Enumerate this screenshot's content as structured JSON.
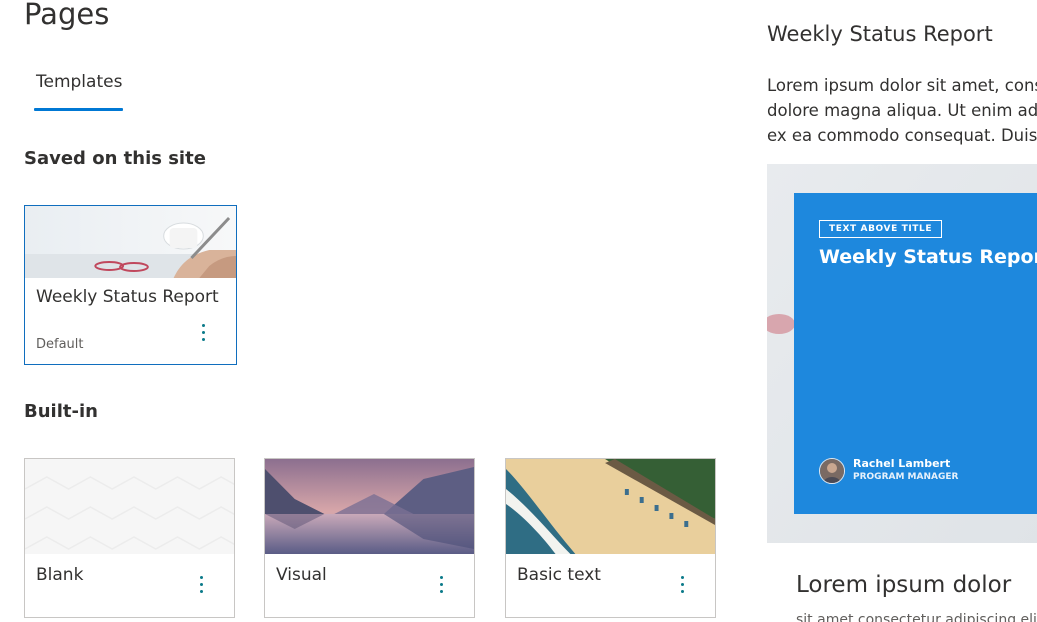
{
  "page": {
    "title": "Pages"
  },
  "tabs": [
    {
      "label": "Templates",
      "active": true
    }
  ],
  "sections": {
    "saved": {
      "heading": "Saved on this site",
      "templates": [
        {
          "name": "Weekly Status Report",
          "subtitle": "Default",
          "thumbnail": "desk-writing-photo",
          "selected": true
        }
      ]
    },
    "builtin": {
      "heading": "Built-in",
      "templates": [
        {
          "name": "Blank",
          "thumbnail": "white-geometric-pattern"
        },
        {
          "name": "Visual",
          "thumbnail": "mountain-lake-photo"
        },
        {
          "name": "Basic text",
          "thumbnail": "aerial-beach-photo"
        }
      ]
    }
  },
  "preview": {
    "title": "Weekly Status Report",
    "description": "Lorem ipsum dolor sit amet, cons\ndolore magna aliqua. Ut enim ad\nex ea commodo consequat. Duis",
    "hero": {
      "tag": "TEXT ABOVE TITLE",
      "title": "Weekly Status Report",
      "author": "Rachel Lambert",
      "role": "PROGRAM MANAGER",
      "background_color": "#1e88dd"
    },
    "section_heading": "Lorem ipsum dolor",
    "section_text_cut": "sit amet consectetur adipiscing elit"
  },
  "colors": {
    "accent": "#0078d4",
    "more_icon": "#0b7a8a",
    "text": "#323130"
  },
  "icons": {
    "more": "more-vertical-icon"
  }
}
